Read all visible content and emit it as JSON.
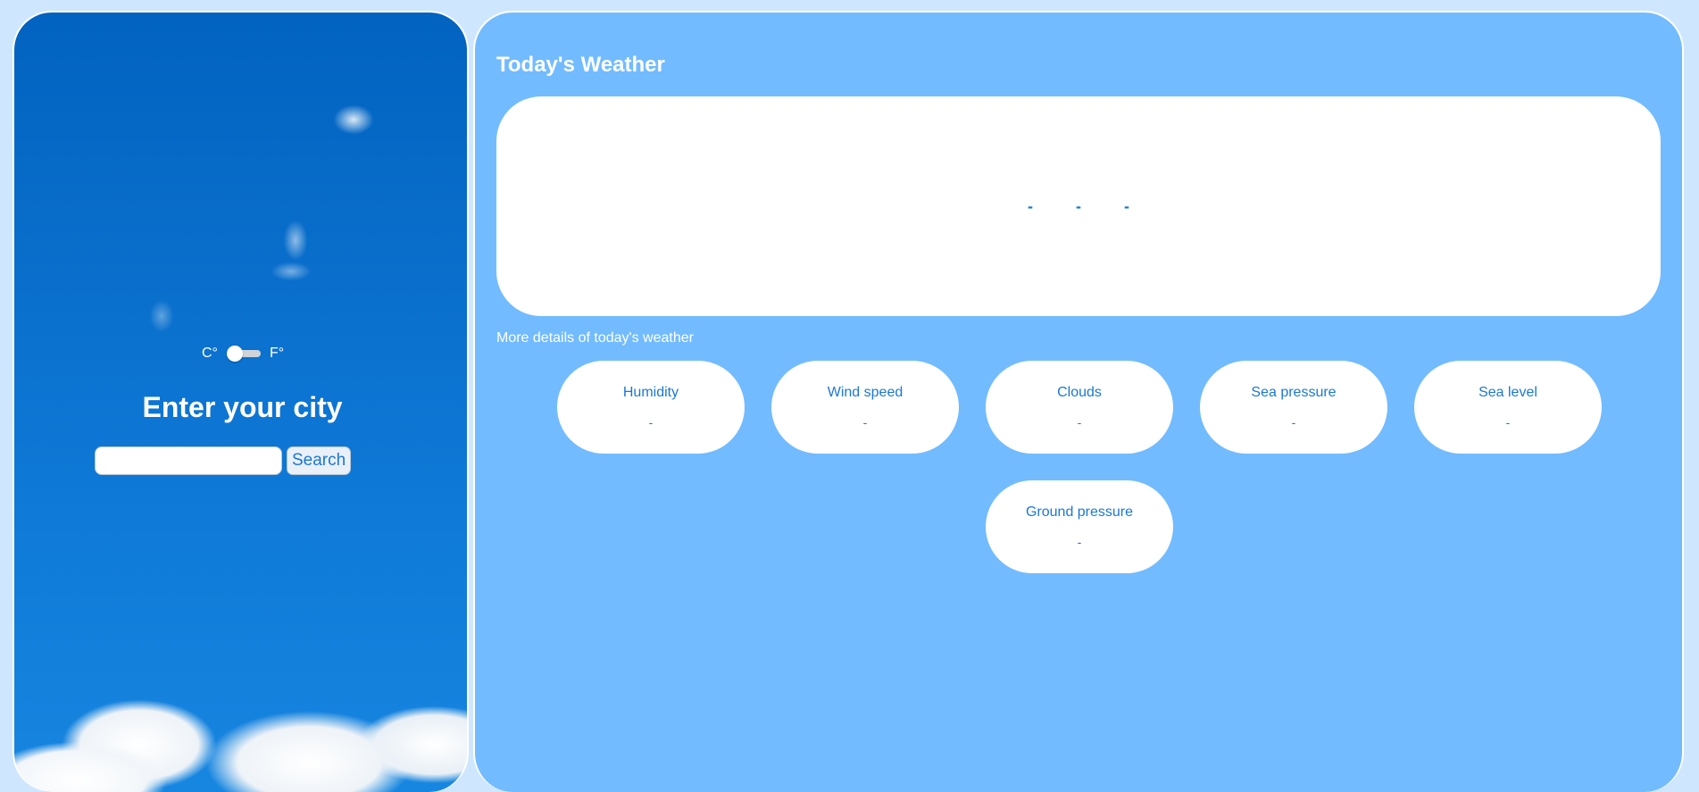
{
  "left_panel": {
    "unit_toggle": {
      "celsius_label": "C°",
      "fahrenheit_label": "F°",
      "selected": "C°"
    },
    "title": "Enter your city",
    "search": {
      "value": "",
      "placeholder": "",
      "button_label": "Search"
    }
  },
  "right_panel": {
    "title": "Today's Weather",
    "today": {
      "values": [
        "-",
        "-",
        "-"
      ]
    },
    "details_label": "More details of today's weather",
    "details": [
      {
        "label": "Humidity",
        "value": "-"
      },
      {
        "label": "Wind speed",
        "value": "-"
      },
      {
        "label": "Clouds",
        "value": "-"
      },
      {
        "label": "Sea pressure",
        "value": "-"
      },
      {
        "label": "Sea level",
        "value": "-"
      },
      {
        "label": "Ground pressure",
        "value": "-"
      }
    ]
  },
  "colors": {
    "page_background": "#cfe6ff",
    "panel_background": "#72bbff",
    "accent": "#1a78d6",
    "card": "#ffffff"
  }
}
